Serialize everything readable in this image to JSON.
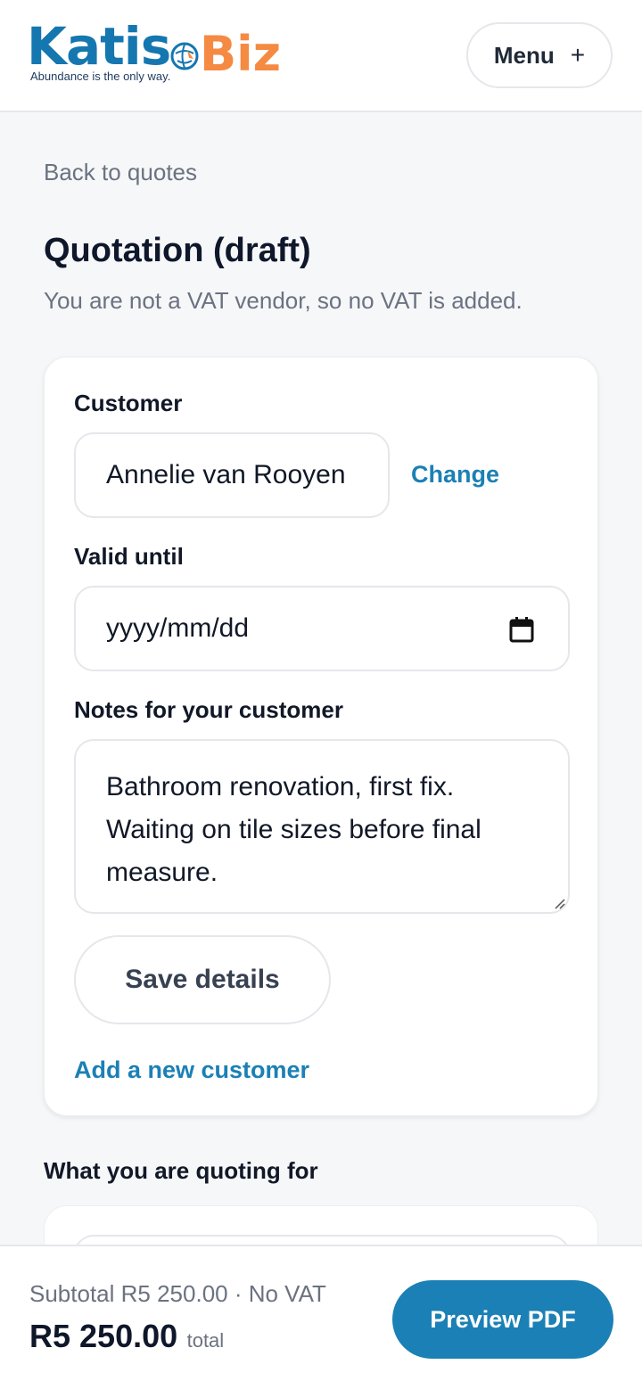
{
  "header": {
    "logo_katis": "Katis",
    "logo_biz": "Biz",
    "logo_tagline": "Abundance is the only way.",
    "menu_label": "Menu",
    "menu_plus": "+",
    "brand_blue": "#1577b0",
    "brand_orange": "#f58a43"
  },
  "nav": {
    "back_label": "Back to quotes"
  },
  "page": {
    "title": "Quotation (draft)",
    "vat_note": "You are not a VAT vendor, so no VAT is added."
  },
  "form": {
    "customer_label": "Customer",
    "customer_value": "Annelie van Rooyen",
    "change_label": "Change",
    "valid_until_label": "Valid until",
    "valid_until_placeholder": "yyyy/mm/dd",
    "notes_label": "Notes for your customer",
    "notes_value": "Bathroom renovation, first fix. Waiting on tile sizes before final measure.",
    "save_label": "Save details",
    "add_customer_label": "Add a new customer",
    "accent_color": "#1b80b5"
  },
  "items": {
    "section_title": "What you are quoting for"
  },
  "footer": {
    "subtotal_text": "Subtotal R5 250.00 · No VAT",
    "total_amount": "R5 250.00",
    "total_word": "total",
    "preview_label": "Preview PDF"
  }
}
